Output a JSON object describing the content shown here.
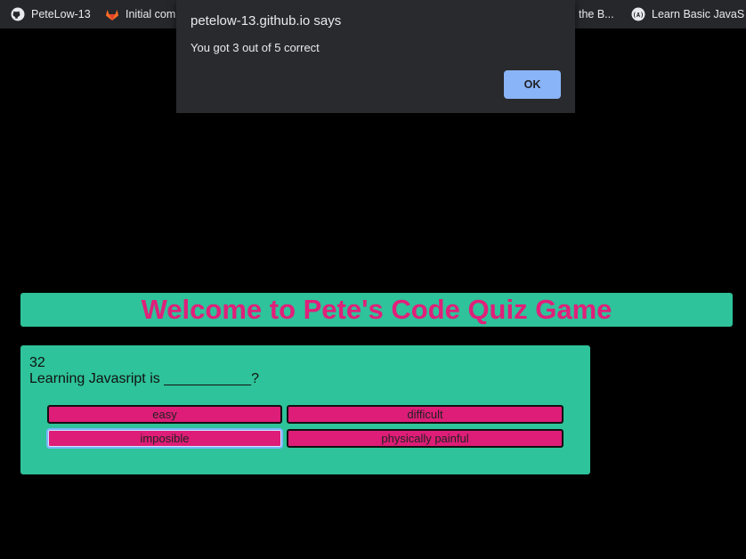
{
  "bookmarks": [
    {
      "label": "PeteLow-13",
      "icon": "github-icon"
    },
    {
      "label": "Initial com",
      "icon": "gitlab-icon"
    },
    {
      "label": "the B...",
      "icon": "bookmark-icon"
    },
    {
      "label": "Learn Basic JavaS",
      "icon": "code-academy-icon"
    }
  ],
  "dialog": {
    "title": "petelow-13.github.io says",
    "message": "You got 3 out of 5 correct",
    "ok_label": "OK"
  },
  "header": {
    "title": "Welcome to Pete's Code Quiz Game"
  },
  "quiz": {
    "timer": "32",
    "question": "Learning Javasript is ___________?",
    "answers": [
      "easy",
      "difficult",
      "imposible",
      "physically painful"
    ]
  },
  "colors": {
    "background": "#000000",
    "teal": "#2ec39a",
    "pink": "#e0207a",
    "button_pink": "#dd1d77",
    "dialog_bg": "#292a2d",
    "dialog_ok": "#8ab4f8"
  }
}
